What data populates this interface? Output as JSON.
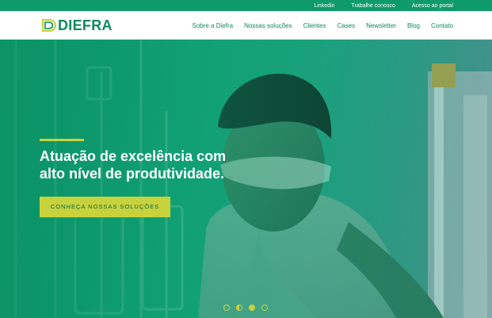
{
  "topbar": {
    "links": [
      "Linkedin",
      "Trabalhe conosco",
      "Acesso ao portal"
    ]
  },
  "header": {
    "logo_text": "DIEFRA",
    "nav": [
      "Sobre a Diefra",
      "Nossas soluções",
      "Clientes",
      "Cases",
      "Newsletter",
      "Blog",
      "Contato"
    ]
  },
  "hero": {
    "headline_line1": "Atuação de excelência com",
    "headline_line2": "alto nível de produtividade.",
    "cta_label": "CONHEÇA NOSSAS SOLUÇÕES",
    "slides_total": 4,
    "active_slide": 3
  },
  "colors": {
    "brand_green": "#0f9a6c",
    "accent_yellow": "#c8d23c",
    "text_white": "#ffffff"
  },
  "icons": [
    "logo-mark-icon",
    "slider-dot-icon"
  ]
}
